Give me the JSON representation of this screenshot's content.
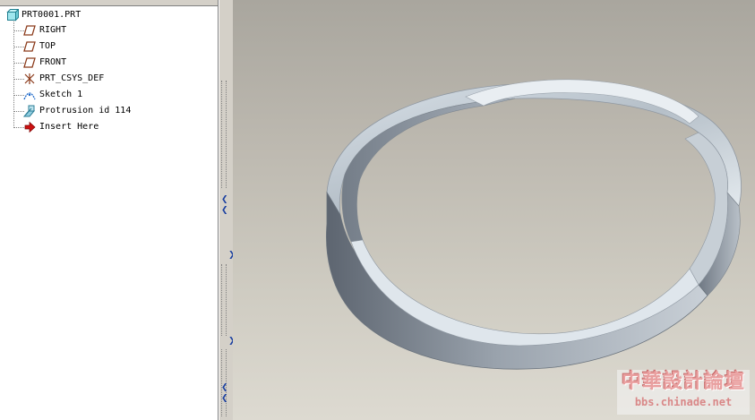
{
  "model_tree": {
    "root": {
      "label": "PRT0001.PRT",
      "icon": "part-icon"
    },
    "items": [
      {
        "label": "RIGHT",
        "icon": "datum-plane-icon"
      },
      {
        "label": "TOP",
        "icon": "datum-plane-icon"
      },
      {
        "label": "FRONT",
        "icon": "datum-plane-icon"
      },
      {
        "label": "PRT_CSYS_DEF",
        "icon": "coordinate-system-icon"
      },
      {
        "label": "Sketch 1",
        "icon": "sketch-icon"
      },
      {
        "label": "Protrusion id 114",
        "icon": "protrusion-icon"
      },
      {
        "label": "Insert Here",
        "icon": "insert-here-arrow-icon"
      }
    ]
  },
  "viewport": {
    "model": "mobius-strip",
    "background_top": "#a9a69e",
    "background_bottom": "#dddad1"
  },
  "watermark": {
    "title": "中華設計論壇",
    "url": "bbs.chinade.net",
    "color": "#e9a0a0"
  },
  "colors": {
    "splitter_arrow": "#1a3fa0",
    "datum_plane": "#8b3a1a",
    "insert_arrow": "#cc1111"
  }
}
